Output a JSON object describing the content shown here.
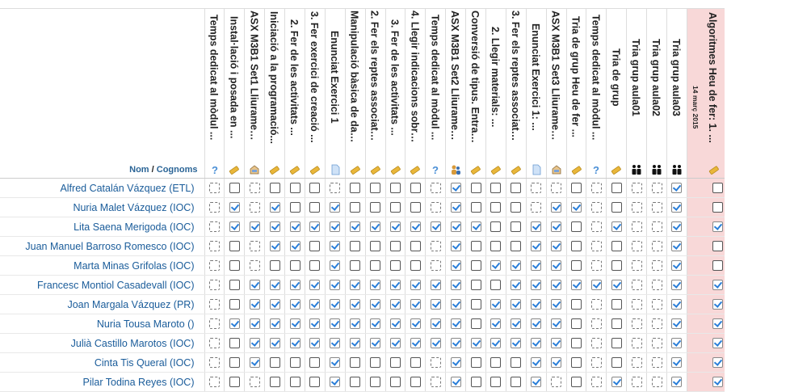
{
  "header": {
    "name_col": {
      "first": "Nom",
      "sep": " / ",
      "last": "Cognoms"
    },
    "columns": [
      {
        "label": "Temps dedicat al mòdul ...",
        "icon": "question-icon"
      },
      {
        "label": "Instal·lació i posada en ...",
        "icon": "pencil-icon"
      },
      {
        "label": "ASX M3B1 Set1 Lliurament ...",
        "icon": "inbox-icon"
      },
      {
        "label": "Iniciació a la programació...",
        "icon": "pencil-icon"
      },
      {
        "label": "2. Fer de les activitats ...",
        "icon": "pencil-icon"
      },
      {
        "label": "3. Fer exercici de creació ...",
        "icon": "pencil-icon"
      },
      {
        "label": "Enunciat Exercici 1",
        "icon": "document-icon"
      },
      {
        "label": "Manipulació bàsica de dades...",
        "icon": "pencil-icon"
      },
      {
        "label": "2. Fer els reptes associats...",
        "icon": "pencil-icon"
      },
      {
        "label": "3. Fer de les activitats ...",
        "icon": "pencil-icon"
      },
      {
        "label": "4. Llegir indicacions sobre...",
        "icon": "pencil-icon"
      },
      {
        "label": "Temps dedicat al mòdul ...",
        "icon": "question-icon"
      },
      {
        "label": "ASX M3B1 Set2 Lliurament ...",
        "icon": "users-icon"
      },
      {
        "label": "Conversió de tipus. Entradà...",
        "icon": "pencil-icon"
      },
      {
        "label": "2. Llegir materials: ...",
        "icon": "pencil-icon"
      },
      {
        "label": "3. Fer els reptes associats...",
        "icon": "pencil-icon"
      },
      {
        "label": "Enunciat Exercici 1: ...",
        "icon": "document-icon"
      },
      {
        "label": "ASX M3B1 Set3 Lliurament ...",
        "icon": "inbox-icon"
      },
      {
        "label": "Tria de grup Heu de fer ...",
        "icon": "pencil-icon"
      },
      {
        "label": "Temps dedicat al mòdul ...",
        "icon": "question-icon"
      },
      {
        "label": "Tria de grup",
        "icon": "pencil-icon"
      },
      {
        "label": "Tria grup aula01",
        "icon": "group-icon"
      },
      {
        "label": "Tria grup aula02",
        "icon": "group-icon"
      },
      {
        "label": "Tria grup aula03",
        "icon": "group-icon"
      },
      {
        "label": "Algoritmes Heu de fer: 1. ...",
        "icon": "pencil-icon",
        "date": "14 març 2015"
      }
    ]
  },
  "rows": [
    {
      "name": "Alfred Catalán Vázquez (ETL)",
      "states": "DEDEEEDEEEEDCEEEDDEDEDDCE"
    },
    {
      "name": "Nuria Malet Vázquez (IOC)",
      "states": "DCDCEECEEEEDCEEEDCCDEDDCE"
    },
    {
      "name": "Lita Saena Merigoda (IOC)",
      "states": "DCCCCCCCCCCCCCEECCEDCDDCC"
    },
    {
      "name": "Juan Manuel Barroso Romesco (IOC)",
      "states": "DEDCCECEEEEDCEEECCEDEDDCE"
    },
    {
      "name": "Marta Minas Grifolas (IOC)",
      "states": "DEDEEECEEEEDCECCCCEDEDDCE"
    },
    {
      "name": "Francesc Montiol Casadevall (IOC)",
      "states": "DECCCCCCCCCCCEECCCCCCDDCC"
    },
    {
      "name": "Joan Margala Vázquez (PR)",
      "states": "DECCCCCCCCCCCECCCCEDEDDCC"
    },
    {
      "name": "Nuria Tousa Maroto ()",
      "states": "DCCCCCCCCCCCCECCCCEDEDDCC"
    },
    {
      "name": "Julià Castillo Marotos (IOC)",
      "states": "DECCCCCCCCCCCCCCCCEDEDDCC"
    },
    {
      "name": "Cinta Tis Queral (IOC)",
      "states": "DECEEECEEEEDCEEECCEDEDDCC"
    },
    {
      "name": "Pilar Todina Reyes (IOC)",
      "states": "DEDEEECEEEEDCEEECDEDCDDCC"
    }
  ],
  "colors": {
    "accent": "#1a5c9a",
    "highlight_column": "#f8d8d8",
    "check": "#2a7ed8"
  }
}
